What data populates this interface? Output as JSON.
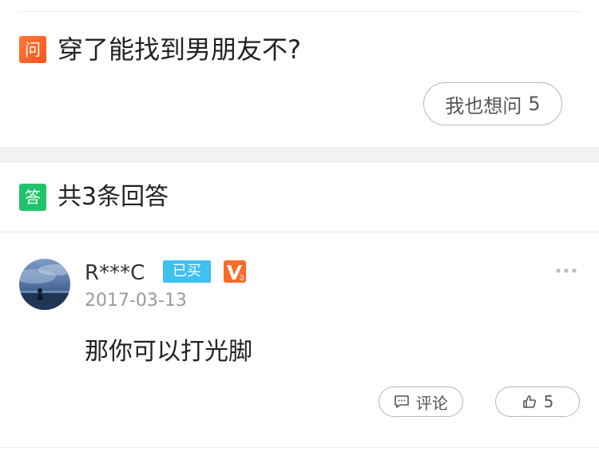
{
  "question": {
    "badge": "问",
    "text": "穿了能找到男朋友不?",
    "ask_button": {
      "label": "我也想问",
      "count": "5"
    }
  },
  "answers_header": {
    "badge": "答",
    "title": "共3条回答"
  },
  "answer": {
    "username": "R***C",
    "bought_badge": "已买",
    "vip_level": "3",
    "date": "2017-03-13",
    "text": "那你可以打光脚",
    "comment_label": "评论",
    "like_count": "5"
  },
  "icons": [
    "comment-icon",
    "like-icon",
    "more-icon",
    "vip-badge-icon"
  ],
  "colors": {
    "question_badge": "#f5531c",
    "answer_badge": "#20c36a",
    "bought_badge": "#3ec0f0",
    "vip_badge": "#ff6a2a"
  }
}
